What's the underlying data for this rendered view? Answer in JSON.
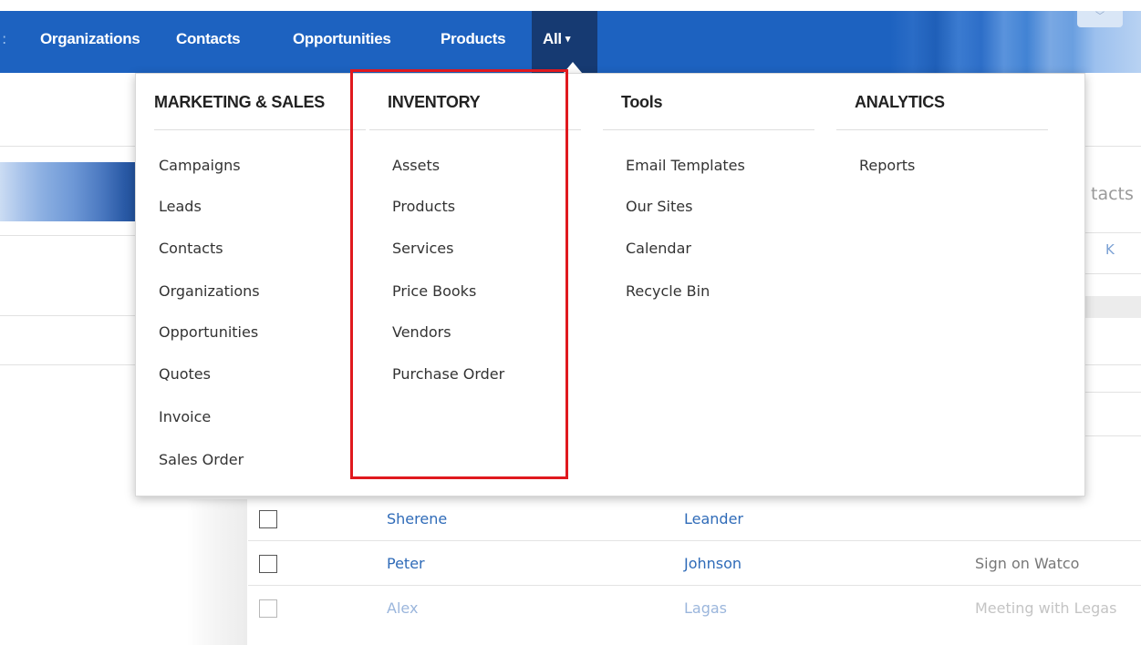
{
  "nav": {
    "items": [
      {
        "label": "Organizations"
      },
      {
        "label": "Contacts"
      },
      {
        "label": "Opportunities"
      },
      {
        "label": "Products"
      },
      {
        "label": "All"
      }
    ],
    "caret": "▾",
    "mini_caret": "﹀"
  },
  "background": {
    "partial_heading": "tacts",
    "partial_letter": "K"
  },
  "dropdown": {
    "columns": [
      {
        "title": "MARKETING & SALES",
        "items": [
          "Campaigns",
          "Leads",
          "Contacts",
          "Organizations",
          "Opportunities",
          "Quotes",
          "Invoice",
          "Sales Order"
        ]
      },
      {
        "title": "INVENTORY",
        "items": [
          "Assets",
          "Products",
          "Services",
          "Price Books",
          "Vendors",
          "Purchase Order"
        ]
      },
      {
        "title": "Tools",
        "items": [
          "Email Templates",
          "Our Sites",
          "Calendar",
          "Recycle Bin"
        ]
      },
      {
        "title": "ANALYTICS",
        "items": [
          "Reports"
        ]
      }
    ]
  },
  "table": {
    "rows": [
      {
        "first": "Sherene",
        "last": "Leander",
        "note": ""
      },
      {
        "first": "Peter",
        "last": "Johnson",
        "note": "Sign on Watco"
      },
      {
        "first": "Alex",
        "last": "Lagas",
        "note": "Meeting with Legas"
      }
    ]
  },
  "colors": {
    "nav_bg": "#1d62c0",
    "nav_active": "#163a72",
    "link": "#2f6bb8",
    "highlight": "#e0191e"
  }
}
